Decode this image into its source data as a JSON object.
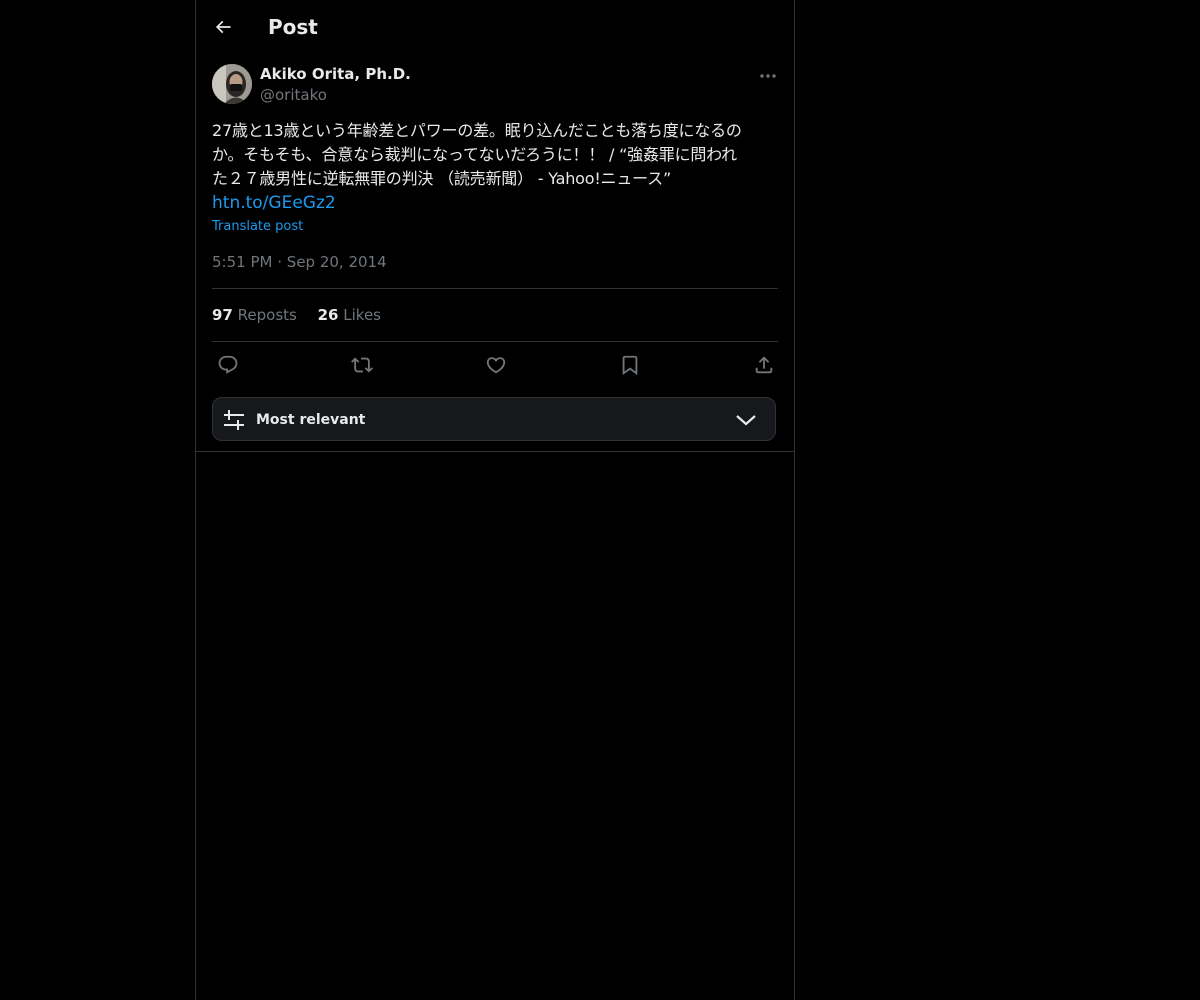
{
  "header": {
    "title": "Post",
    "back_icon": "arrow-left-icon"
  },
  "post": {
    "author": {
      "name": "Akiko Orita, Ph.D.",
      "handle": "@oritako"
    },
    "text_lines": [
      "27歳と13歳という年齢差とパワーの差。眠り込んだことも落ち度になるの",
      "か。そもそも、合意なら裁判になってないだろうに！！ / “強姦罪に問われ",
      "た２７歳男性に逆転無罪の判決 （読売新聞） - Yahoo!ニュース”"
    ],
    "link": "htn.to/GEeGz2",
    "translate_label": "Translate post",
    "time": "5:51 PM",
    "separator": "·",
    "date": "Sep 20, 2014"
  },
  "stats": {
    "reposts_count": "97",
    "reposts_label": "Reposts",
    "likes_count": "26",
    "likes_label": "Likes"
  },
  "actions": {
    "icons": [
      "reply-icon",
      "repost-icon",
      "like-icon",
      "bookmark-icon",
      "share-icon"
    ]
  },
  "sort": {
    "label": "Most relevant",
    "icon": "filter-sliders-icon",
    "chevron": "chevron-down-icon"
  },
  "colors": {
    "background": "#000000",
    "text": "#e7e9ea",
    "muted": "#71767b",
    "link": "#1d9bf0",
    "border": "#2f3336"
  }
}
